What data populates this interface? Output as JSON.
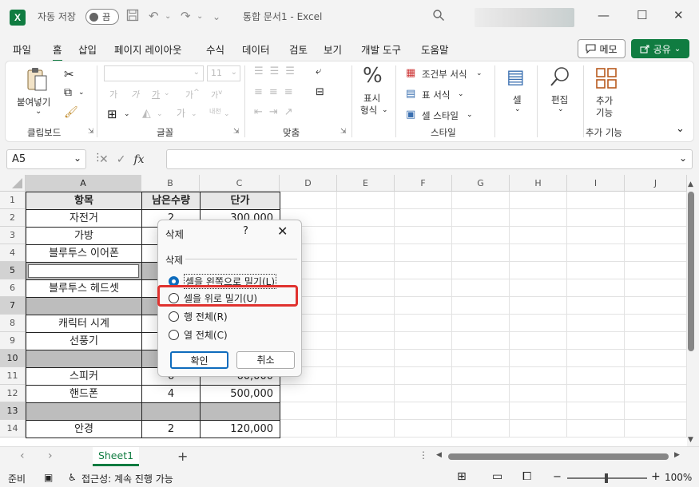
{
  "titlebar": {
    "logo_letter": "X",
    "autosave_label": "자동 저장",
    "autosave_state": "끔",
    "doc_title": "통합 문서1  -  Excel"
  },
  "menu": {
    "items": [
      "파일",
      "홈",
      "삽입",
      "페이지 레이아웃",
      "수식",
      "데이터",
      "검토",
      "보기",
      "개발 도구",
      "도움말"
    ],
    "active": "홈",
    "memo_label": "메모",
    "share_label": "공유"
  },
  "ribbon": {
    "paste_label": "붙여넣기",
    "clipboard_group": "클립보드",
    "font_group": "글꼴",
    "font_size": "11",
    "font_sample_1": "가",
    "font_sample_2": "가",
    "font_sample_3": "가",
    "font_sample_4": "가",
    "phonetic_label": "내천",
    "align_group": "맞춤",
    "number_label_1": "표시",
    "number_label_2": "형식",
    "conditional_format": "조건부 서식",
    "table_format": "표 서식",
    "cell_style": "셀 스타일",
    "style_group": "스타일",
    "cells_label": "셀",
    "edit_label": "편집",
    "addin_label_1": "추가",
    "addin_label_2": "기능",
    "addin_group": "추가 기능"
  },
  "formula_bar": {
    "name_box": "A5",
    "fx": "fx",
    "value": ""
  },
  "grid": {
    "columns": [
      "A",
      "B",
      "C",
      "D",
      "E",
      "F",
      "G",
      "H",
      "I",
      "J"
    ],
    "rows": [
      "1",
      "2",
      "3",
      "4",
      "5",
      "6",
      "7",
      "8",
      "9",
      "10",
      "11",
      "12",
      "13",
      "14"
    ],
    "headers": [
      "항목",
      "남은수량",
      "단가"
    ],
    "data": [
      [
        "자전거",
        "2",
        "300,000"
      ],
      [
        "가방",
        "",
        ""
      ],
      [
        "블루투스 이어폰",
        "",
        ""
      ],
      [
        "",
        "",
        ""
      ],
      [
        "블루투스 헤드셋",
        "",
        ""
      ],
      [
        "",
        "",
        ""
      ],
      [
        "캐릭터 시계",
        "",
        ""
      ],
      [
        "선풍기",
        "",
        ""
      ],
      [
        "",
        "",
        ""
      ],
      [
        "스피커",
        "6",
        "60,000"
      ],
      [
        "핸드폰",
        "4",
        "500,000"
      ],
      [
        "",
        "",
        ""
      ],
      [
        "안경",
        "2",
        "120,000"
      ]
    ]
  },
  "dialog": {
    "title": "삭제",
    "help": "?",
    "close": "✕",
    "section": "삭제",
    "options": [
      "셀을 왼쪽으로 밀기(L)",
      "셀을 위로 밀기(U)",
      "행 전체(R)",
      "열 전체(C)"
    ],
    "selected_index": 0,
    "ok_label": "확인",
    "cancel_label": "취소"
  },
  "sheets": {
    "tab": "Sheet1",
    "add": "+"
  },
  "status": {
    "ready": "준비",
    "accessibility": "접근성: 계속 진행 가능",
    "zoom": "100%"
  },
  "colors": {
    "accent": "#107c41",
    "highlight": "#e0322f",
    "radio": "#0f6cbd"
  }
}
